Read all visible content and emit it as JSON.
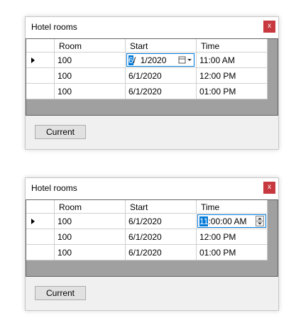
{
  "windows": [
    {
      "title": "Hotel rooms",
      "close_glyph": "x",
      "columns": [
        "Room",
        "Start",
        "Time"
      ],
      "rows": [
        [
          "100",
          "6/1/2020",
          "11:00 AM"
        ],
        [
          "100",
          "6/1/2020",
          "12:00 PM"
        ],
        [
          "100",
          "6/1/2020",
          "01:00 PM"
        ]
      ],
      "editor": {
        "column": "Start",
        "selected": "6",
        "rest": "/  1/2020",
        "icon": "calendar-dropdown-icon"
      },
      "button_label": "Current"
    },
    {
      "title": "Hotel rooms",
      "close_glyph": "x",
      "columns": [
        "Room",
        "Start",
        "Time"
      ],
      "rows": [
        [
          "100",
          "6/1/2020",
          "11:00 AM"
        ],
        [
          "100",
          "6/1/2020",
          "12:00 PM"
        ],
        [
          "100",
          "6/1/2020",
          "01:00 PM"
        ]
      ],
      "editor": {
        "column": "Time",
        "selected": "11",
        "rest": ":00:00 AM",
        "icon": "spin-updown-icon"
      },
      "button_label": "Current"
    }
  ]
}
